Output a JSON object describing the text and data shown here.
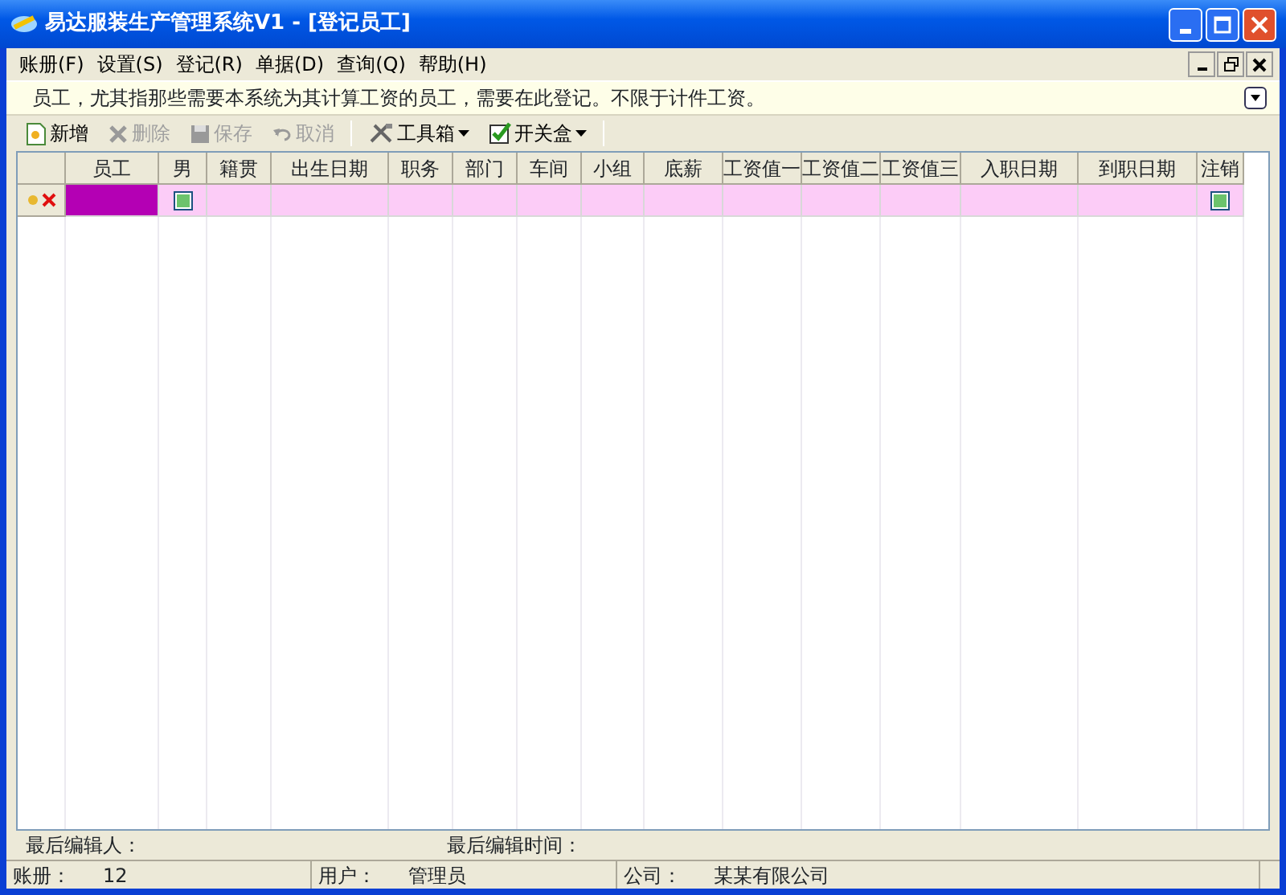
{
  "window": {
    "title": "易达服装生产管理系统V1 - [登记员工]"
  },
  "menu": [
    {
      "label": "账册(F)"
    },
    {
      "label": "设置(S)"
    },
    {
      "label": "登记(R)"
    },
    {
      "label": "单据(D)"
    },
    {
      "label": "查询(Q)"
    },
    {
      "label": "帮助(H)"
    }
  ],
  "info_bar": {
    "text": "员工，尤其指那些需要本系统为其计算工资的员工，需要在此登记。不限于计件工资。"
  },
  "toolbar": [
    {
      "kind": "new",
      "label": "新增",
      "disabled": false
    },
    {
      "kind": "delete",
      "label": "删除",
      "disabled": true
    },
    {
      "kind": "save",
      "label": "保存",
      "disabled": true
    },
    {
      "kind": "undo",
      "label": "取消",
      "disabled": true
    },
    {
      "kind": "separator"
    },
    {
      "kind": "tools",
      "label": "工具箱",
      "disabled": false
    },
    {
      "kind": "switch",
      "label": "开关盒",
      "disabled": false
    },
    {
      "kind": "separator"
    }
  ],
  "table": {
    "columns": [
      "员工",
      "男",
      "籍贯",
      "出生日期",
      "职务",
      "部门",
      "车间",
      "小组",
      "底薪",
      "工资值一",
      "工资值二",
      "工资值三",
      "入职日期",
      "到职日期",
      "注销"
    ],
    "rows": [
      {
        "new": true,
        "cells": [
          {
            "kind": "text",
            "selected": true
          },
          {
            "kind": "checkbox",
            "indeterminate": true,
            "selected": false
          },
          {
            "kind": "text",
            "selected": false
          },
          {
            "kind": "text",
            "selected": false
          },
          {
            "kind": "text",
            "selected": false
          },
          {
            "kind": "text",
            "selected": false
          },
          {
            "kind": "text",
            "selected": false
          },
          {
            "kind": "text",
            "selected": false
          },
          {
            "kind": "text",
            "selected": false
          },
          {
            "kind": "text",
            "selected": false
          },
          {
            "kind": "text",
            "selected": false
          },
          {
            "kind": "text",
            "selected": false
          },
          {
            "kind": "text",
            "selected": false
          },
          {
            "kind": "text",
            "selected": false
          },
          {
            "kind": "checkbox",
            "indeterminate": true,
            "selected": false
          }
        ]
      }
    ]
  },
  "edit_info": [
    {
      "label": "最后编辑人："
    },
    {
      "label": "最后编辑时间："
    }
  ],
  "status_bar": [
    {
      "label": "账册：",
      "value": "12"
    },
    {
      "label": "用户：",
      "value": "管理员"
    },
    {
      "label": "公司：",
      "value": "某某有限公司"
    }
  ]
}
